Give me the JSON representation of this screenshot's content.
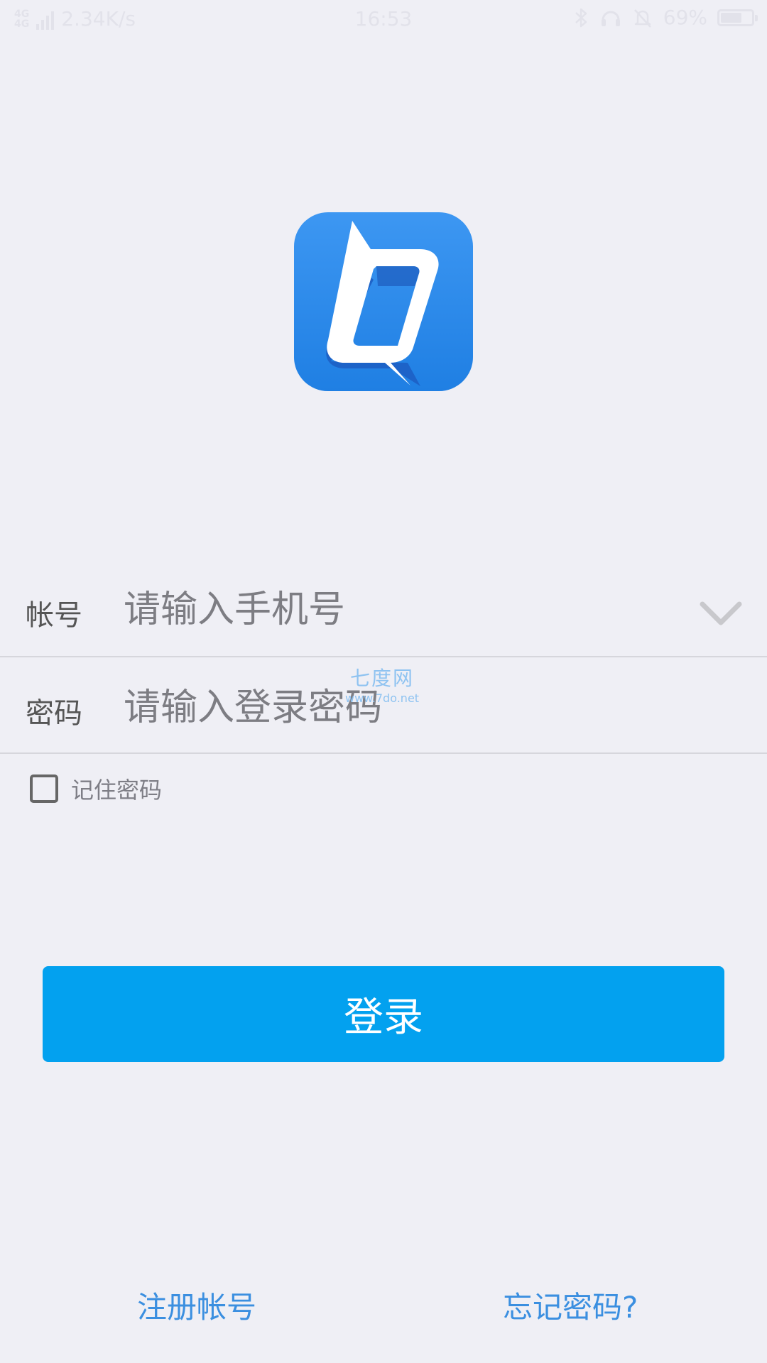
{
  "status_bar": {
    "network": [
      "4G",
      "4G"
    ],
    "speed": "2.34K/s",
    "time": "16:53",
    "battery": "69%",
    "battery_level": 0.69,
    "icons": [
      "bluetooth-icon",
      "headset-icon",
      "bell-muted-icon",
      "battery-icon"
    ]
  },
  "logo": {
    "icon": "app-logo-icon",
    "colors": {
      "background": "#2a8aeb",
      "shape": "#ffffff",
      "shadow": "#1e59b8"
    }
  },
  "form": {
    "account": {
      "label": "帐号",
      "placeholder": "请输入手机号",
      "dropdown_icon": "chevron-down-icon"
    },
    "password": {
      "label": "密码",
      "placeholder": "请输入登录密码"
    },
    "remember": {
      "label": "记住密码",
      "checked": false
    }
  },
  "watermark": {
    "title": "七度网",
    "url": "www.7do.net"
  },
  "login_button": {
    "label": "登录",
    "color": "#03a1ef"
  },
  "links": {
    "register": "注册帐号",
    "forgot": "忘记密码?"
  }
}
